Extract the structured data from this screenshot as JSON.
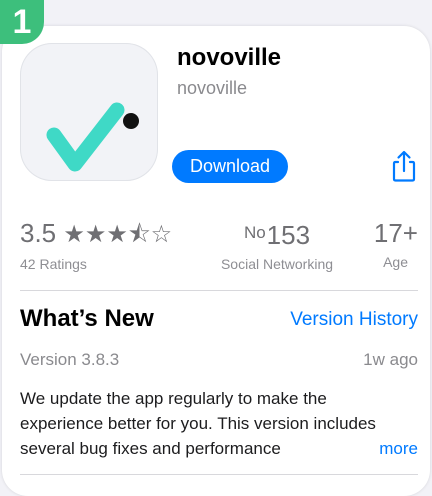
{
  "step": {
    "number": "1"
  },
  "app": {
    "name": "novoville",
    "developer": "novoville",
    "download_label": "Download"
  },
  "stats": {
    "rating": {
      "value": "3.5",
      "stars": "★★★⯪☆",
      "sub": "42 Ratings"
    },
    "rank": {
      "prefix": "No",
      "value": "153",
      "sub": "Social Networking"
    },
    "age": {
      "value": "17+",
      "sub": "Age"
    }
  },
  "whats_new": {
    "title": "What’s New",
    "history_link": "Version History",
    "version": "Version 3.8.3",
    "time_ago": "1w ago",
    "notes_lines": [
      "We update the app regularly to make the",
      "experience better for you. This version includes",
      "several bug fixes and performance"
    ],
    "more_label": "more"
  },
  "colors": {
    "accent": "#007aff",
    "badge": "#3dbf7c",
    "check": "#3fd9c6",
    "dot": "#111111"
  },
  "icons": {
    "share": "share-icon",
    "app": "checkmark-app-icon"
  }
}
